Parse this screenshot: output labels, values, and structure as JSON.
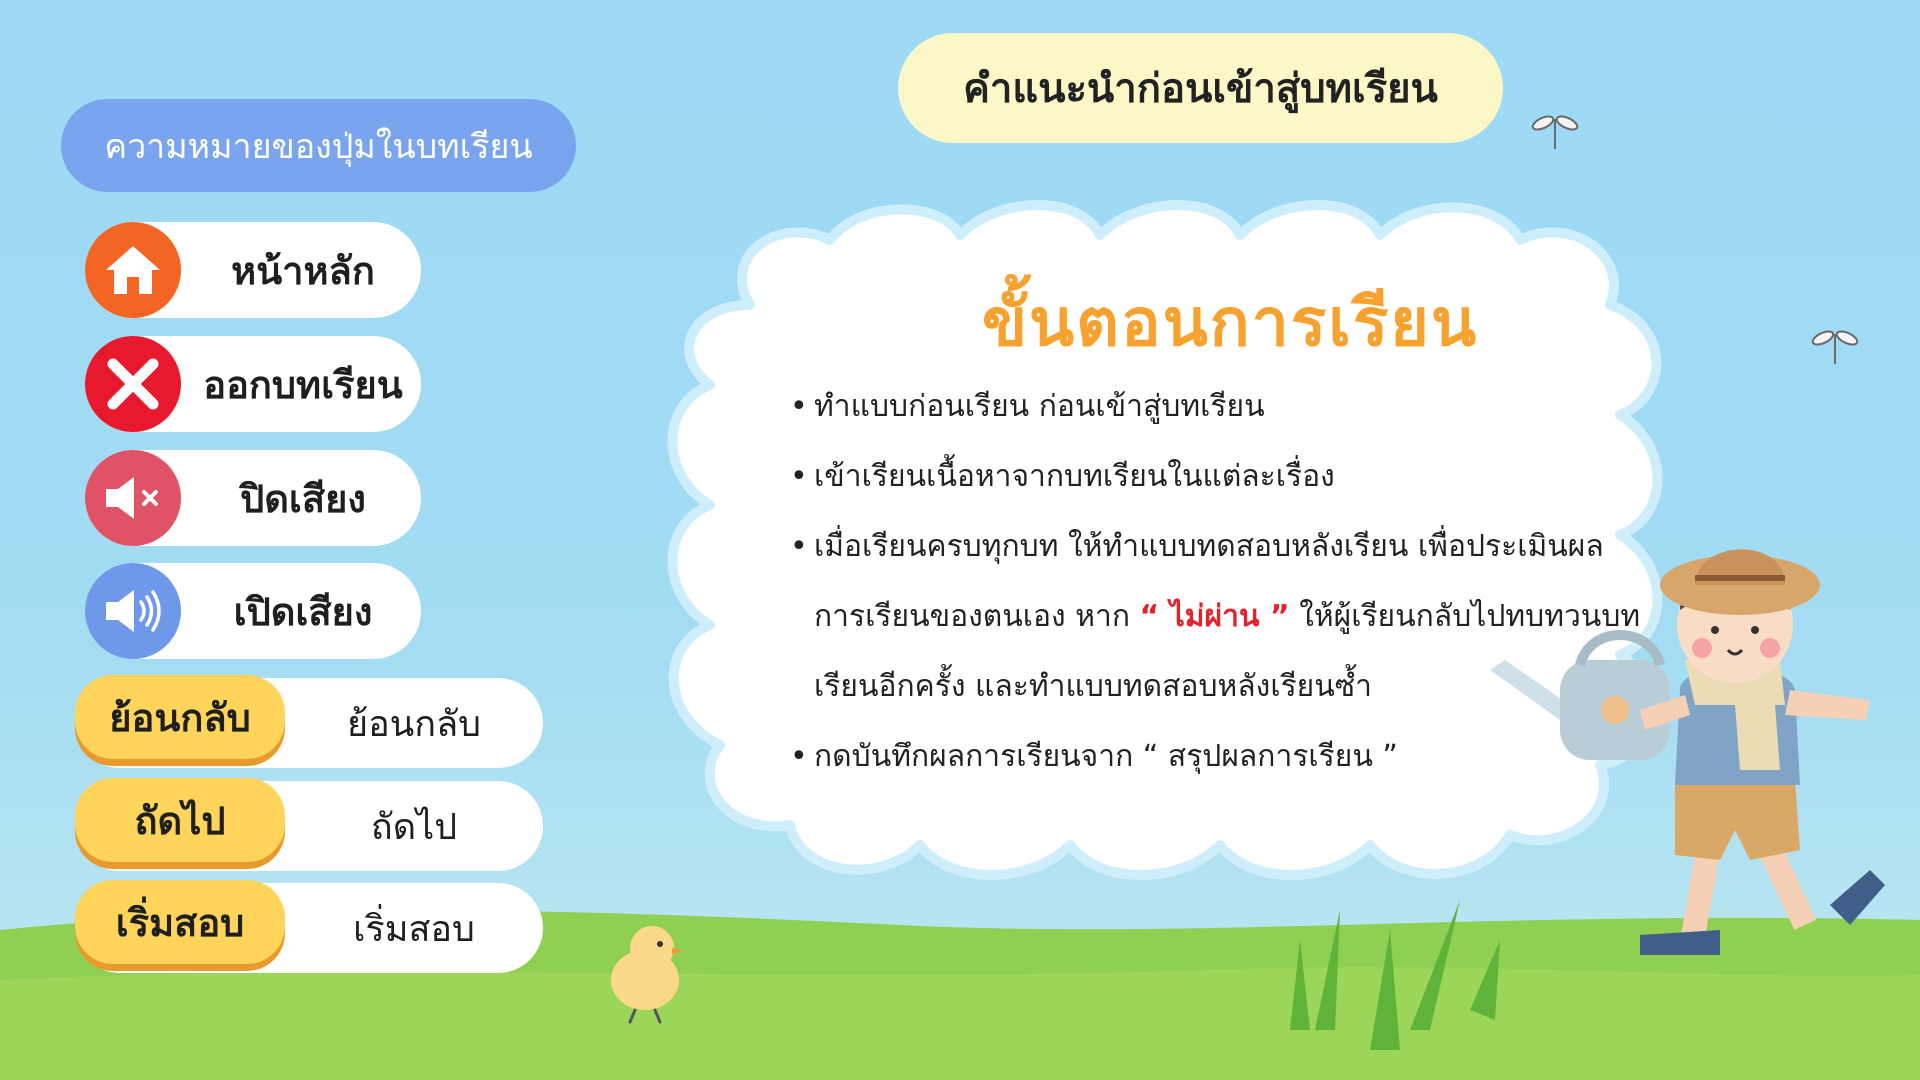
{
  "header": {
    "title": "คำแนะนำก่อนเข้าสู่บทเรียน"
  },
  "legend": {
    "title": "ความหมายของปุ่มในบทเรียน",
    "icon_buttons": [
      {
        "label": "หน้าหลัก",
        "icon": "home-icon",
        "color": "#f26522"
      },
      {
        "label": "ออกบทเรียน",
        "icon": "close-icon",
        "color": "#e8192c"
      },
      {
        "label": "ปิดเสียง",
        "icon": "mute-icon",
        "color": "#e05266"
      },
      {
        "label": "เปิดเสียง",
        "icon": "speaker-icon",
        "color": "#6f98ea"
      }
    ],
    "text_buttons": [
      {
        "button": "ย้อนกลับ",
        "label": "ย้อนกลับ"
      },
      {
        "button": "ถัดไป",
        "label": "ถัดไป"
      },
      {
        "button": "เริ่มสอบ",
        "label": "เริ่มสอบ"
      }
    ]
  },
  "content": {
    "heading": "ขั้นตอนการเรียน",
    "steps": {
      "s1": "ทำแบบก่อนเรียน ก่อนเข้าสู่บทเรียน",
      "s2": "เข้าเรียนเนื้อหาจากบทเรียนในแต่ละเรื่อง",
      "s3_line1": "เมื่อเรียนครบทุกบท ให้ทำแบบทดสอบหลังเรียน เพื่อประเมินผล",
      "s3_line2_pre": "การเรียนของตนเอง  หาก ",
      "s3_highlight": "“ ไม่ผ่าน ”",
      "s3_line2_post": " ให้ผู้เรียนกลับไปทบทวนบท",
      "s3_line3": "เรียนอีกครั้ง และทำแบบทดสอบหลังเรียนซ้ำ",
      "s4": "กดบันทึกผลการเรียนจาก  “ สรุปผลการเรียน ”"
    }
  },
  "colors": {
    "sky": "#9dd9f5",
    "banner": "#fbf7c6",
    "legend_title_bg": "#7aa5ee",
    "heading": "#f7a12e",
    "highlight": "#e3222b",
    "gold": "#ffd45a",
    "gold_shadow": "#e89a2c",
    "grass": "#8fcf52"
  }
}
